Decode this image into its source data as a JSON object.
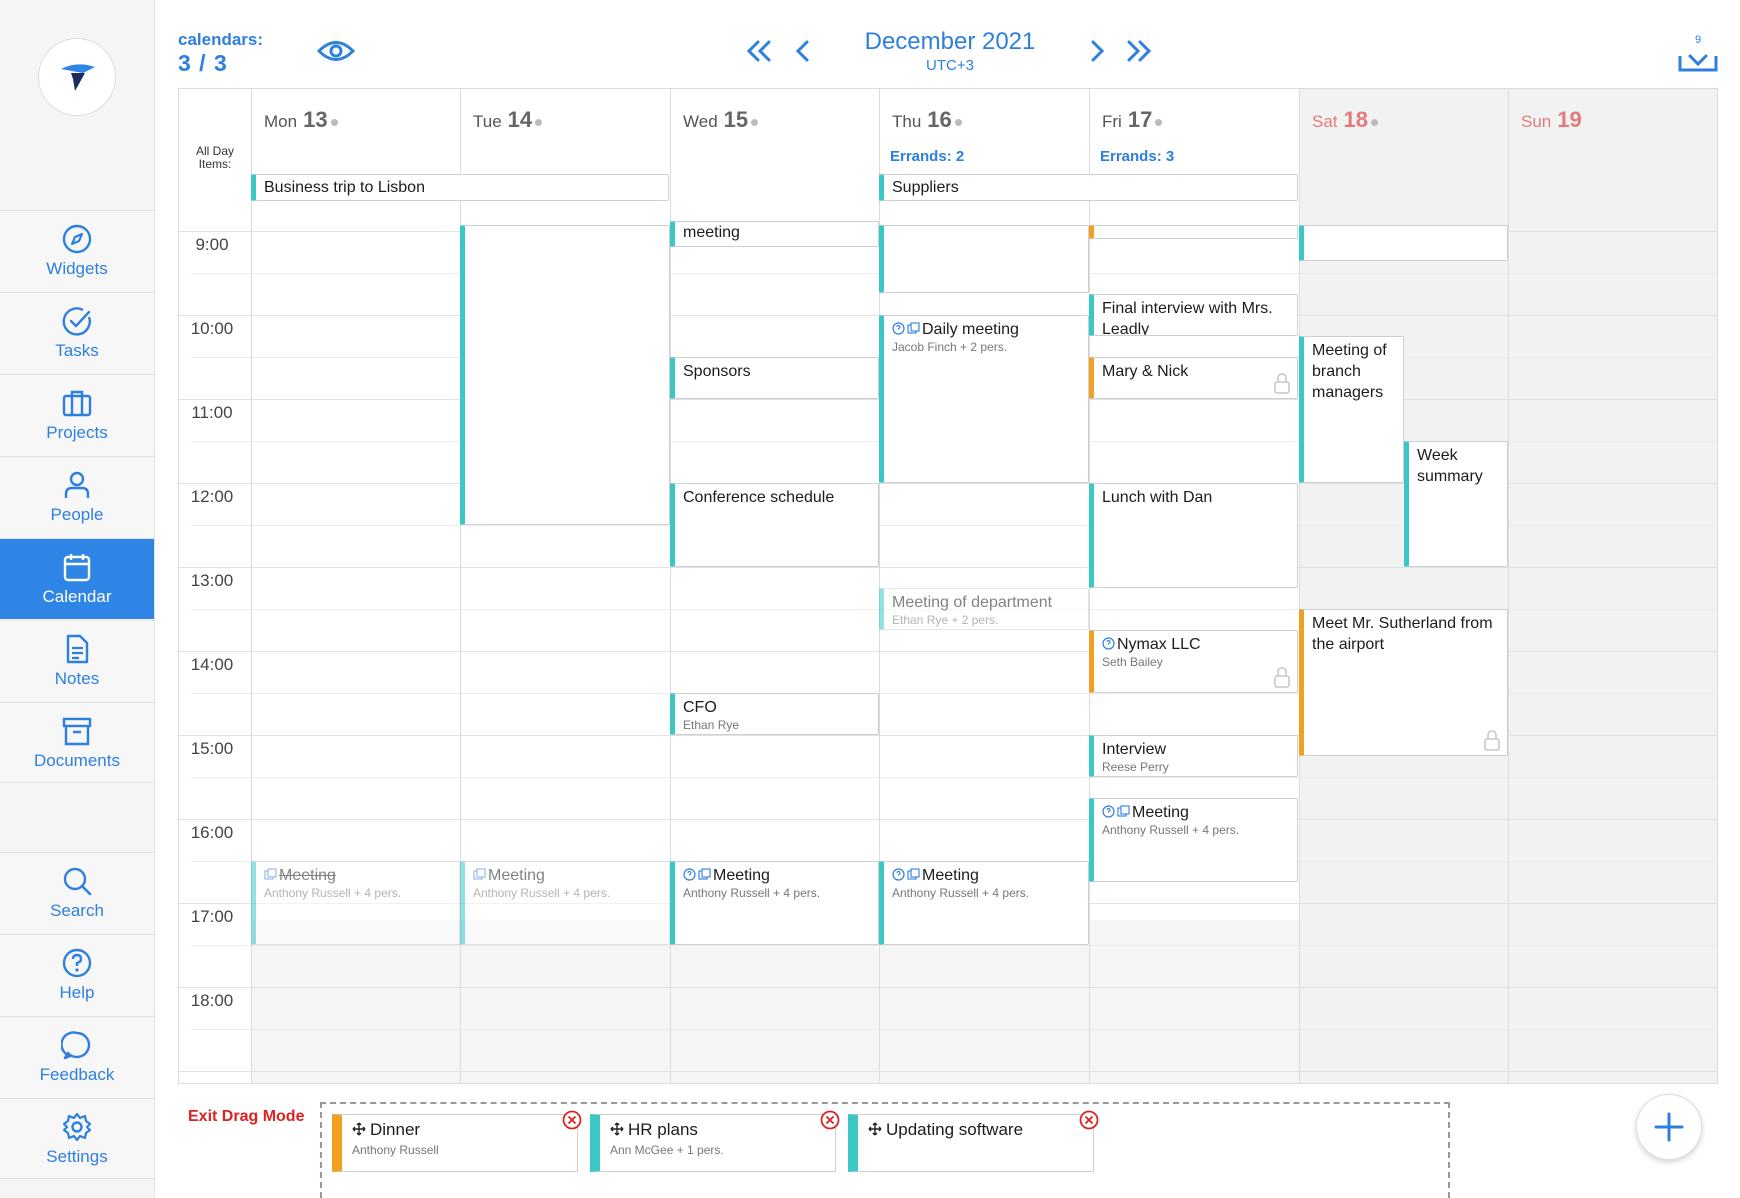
{
  "sidebar": {
    "items": [
      {
        "label": "Widgets",
        "icon": "compass-icon"
      },
      {
        "label": "Tasks",
        "icon": "check-circle-icon"
      },
      {
        "label": "Projects",
        "icon": "briefcase-icon"
      },
      {
        "label": "People",
        "icon": "person-icon"
      },
      {
        "label": "Calendar",
        "icon": "calendar-icon",
        "active": true
      },
      {
        "label": "Notes",
        "icon": "note-icon"
      },
      {
        "label": "Documents",
        "icon": "archive-box-icon"
      }
    ],
    "bottom_items": [
      {
        "label": "Search",
        "icon": "search-icon"
      },
      {
        "label": "Help",
        "icon": "question-icon"
      },
      {
        "label": "Feedback",
        "icon": "chat-bubble-icon"
      },
      {
        "label": "Settings",
        "icon": "gear-icon"
      }
    ]
  },
  "header": {
    "calendars_label": "calendars:",
    "calendars_value": "3 / 3",
    "month": "December 2021",
    "timezone": "UTC+3",
    "download_count": "9"
  },
  "days": [
    {
      "name": "Mon",
      "num": "13",
      "errands": ""
    },
    {
      "name": "Tue",
      "num": "14",
      "errands": ""
    },
    {
      "name": "Wed",
      "num": "15",
      "errands": ""
    },
    {
      "name": "Thu",
      "num": "16",
      "errands": "Errands: 2"
    },
    {
      "name": "Fri",
      "num": "17",
      "errands": "Errands: 3"
    },
    {
      "name": "Sat",
      "num": "18",
      "errands": "",
      "weekend": true
    },
    {
      "name": "Sun",
      "num": "19",
      "errands": "",
      "weekend": true
    }
  ],
  "allday_label": "All Day Items:",
  "allday_events": [
    {
      "title": "Business trip to Lisbon"
    },
    {
      "title": "Suppliers"
    }
  ],
  "times": [
    "9:00",
    "10:00",
    "11:00",
    "12:00",
    "13:00",
    "14:00",
    "15:00",
    "16:00",
    "17:00",
    "18:00"
  ],
  "events": [
    {
      "title": "meeting",
      "sub": ""
    },
    {
      "title": "Daily meeting",
      "sub": "Jacob Finch + 2 pers."
    },
    {
      "title": "Final interview with Mrs. Leadly",
      "sub": ""
    },
    {
      "title": "Sponsors",
      "sub": ""
    },
    {
      "title": "Mary & Nick",
      "sub": ""
    },
    {
      "title": "Meeting of branch managers",
      "sub": ""
    },
    {
      "title": "Week summary",
      "sub": ""
    },
    {
      "title": "Conference schedule",
      "sub": ""
    },
    {
      "title": "Lunch with Dan",
      "sub": ""
    },
    {
      "title": "Meeting of department",
      "sub": "Ethan Rye + 2 pers."
    },
    {
      "title": "Meet Mr. Sutherland from the airport",
      "sub": ""
    },
    {
      "title": "Nymax LLC",
      "sub": "Seth Bailey"
    },
    {
      "title": "CFO",
      "sub": "Ethan Rye"
    },
    {
      "title": "Interview",
      "sub": "Reese Perry"
    },
    {
      "title": "Meeting",
      "sub": "Anthony Russell + 4 pers."
    },
    {
      "title": "Meeting",
      "sub": "Anthony Russell + 4 pers."
    },
    {
      "title": "Meeting",
      "sub": "Anthony Russell + 4 pers."
    },
    {
      "title": "Meeting",
      "sub": "Anthony Russell + 4 pers."
    },
    {
      "title": "Meeting",
      "sub": "Anthony Russell + 4 pers."
    }
  ],
  "dock": {
    "exit_label": "Exit Drag Mode",
    "cards": [
      {
        "title": "Dinner",
        "sub": "Anthony Russell"
      },
      {
        "title": "HR plans",
        "sub": "Ann McGee + 1 pers."
      },
      {
        "title": "Updating software",
        "sub": ""
      }
    ]
  },
  "colors": {
    "accent": "#2e85e6",
    "teal": "#3cc7c7",
    "orange": "#f0a123",
    "weekend_text": "#e37a7a",
    "danger": "#dd2222"
  }
}
